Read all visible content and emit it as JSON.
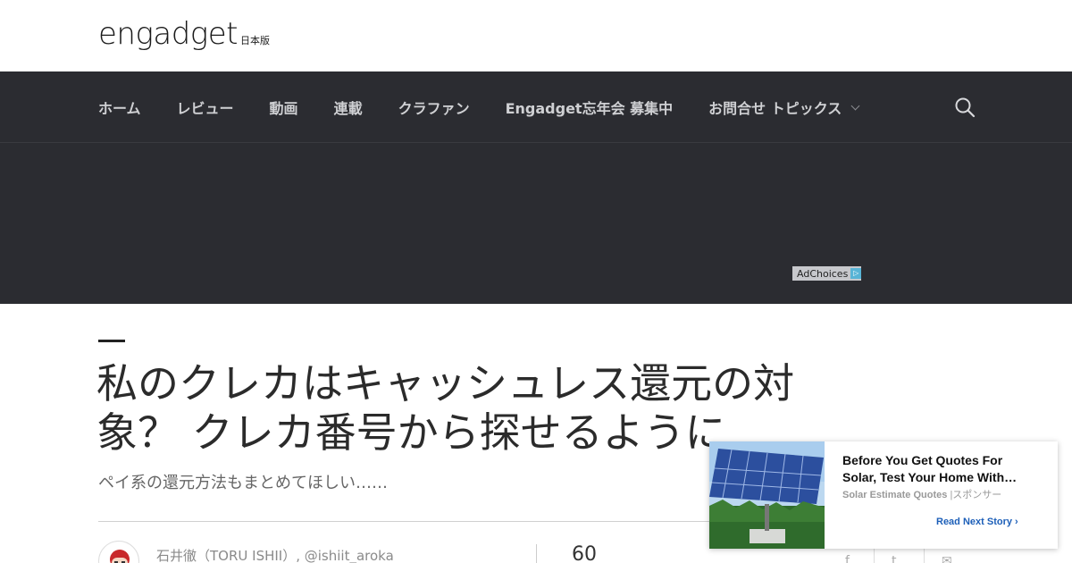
{
  "header": {
    "logo_text": "engadget",
    "logo_sub": "日本版"
  },
  "nav": {
    "items": [
      "ホーム",
      "レビュー",
      "動画",
      "連載",
      "クラファン",
      "Engadget忘年会 募集中",
      "お問合せ トピックス"
    ],
    "search_icon": "search-icon"
  },
  "ad": {
    "adchoices_label": "AdChoices",
    "adchoices_icon": "▷"
  },
  "article": {
    "title": "私のクレカはキャッシュレス還元の対象？ クレカ番号から探せるように",
    "subtitle": "ペイ系の還元方法もまとめてほしい……",
    "author": "石井徹（TORU ISHII）, @ishiit_aroka",
    "share_count": "60",
    "share_icons": [
      "f",
      "t",
      "✉"
    ]
  },
  "sponsored": {
    "title": "Before You Get Quotes For Solar, Test Your Home With…",
    "source": "Solar Estimate Quotes",
    "separator": "|",
    "label": "スポンサー",
    "cta": "Read Next Story ›"
  },
  "colors": {
    "nav_bg": "#2b2c31",
    "cta_blue": "#1d5fb8"
  }
}
